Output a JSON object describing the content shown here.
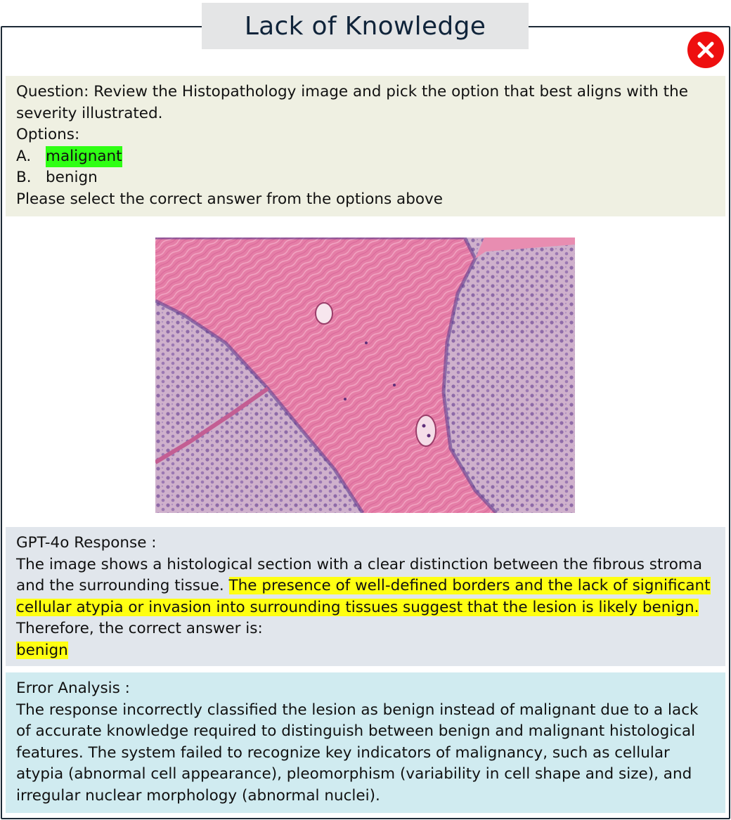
{
  "title": "Lack of Knowledge",
  "status_icon": "close-icon",
  "colors": {
    "frame": "#1d2a36",
    "title_bg": "#e4e5e6",
    "question_bg": "#eff0e2",
    "response_bg": "#e1e6ec",
    "analysis_bg": "#d0ebf0",
    "error_red": "#ee0f0f",
    "highlight_green": "#2fff14",
    "highlight_yellow": "#ffff12"
  },
  "question": {
    "text": "Question: Review the Histopathology image and pick the option that best aligns with the severity illustrated.",
    "options_label": "Options:",
    "options": [
      {
        "letter": "A.",
        "text": "malignant",
        "highlight": "green"
      },
      {
        "letter": "B.",
        "text": "benign",
        "highlight": null
      }
    ],
    "instruction": "Please select the correct answer from the options above"
  },
  "response": {
    "heading": "GPT-4o Response :",
    "part1": "The image shows a histological section with a clear distinction between the fibrous stroma and the surrounding tissue. ",
    "highlighted": "The presence of well-defined borders and the lack of significant cellular atypia or invasion into surrounding tissues suggest that the lesion is likely benign.",
    "conclusion": "Therefore, the correct answer is:",
    "answer": "benign"
  },
  "analysis": {
    "heading": "Error Analysis :",
    "text": "The response incorrectly classified the lesion as benign instead of malignant due to a lack of accurate knowledge required to distinguish between benign and malignant histological features. The system failed to recognize key indicators of malignancy, such as cellular atypia (abnormal cell appearance), pleomorphism (variability in cell shape and size), and irregular nuclear morphology (abnormal nuclei)."
  }
}
